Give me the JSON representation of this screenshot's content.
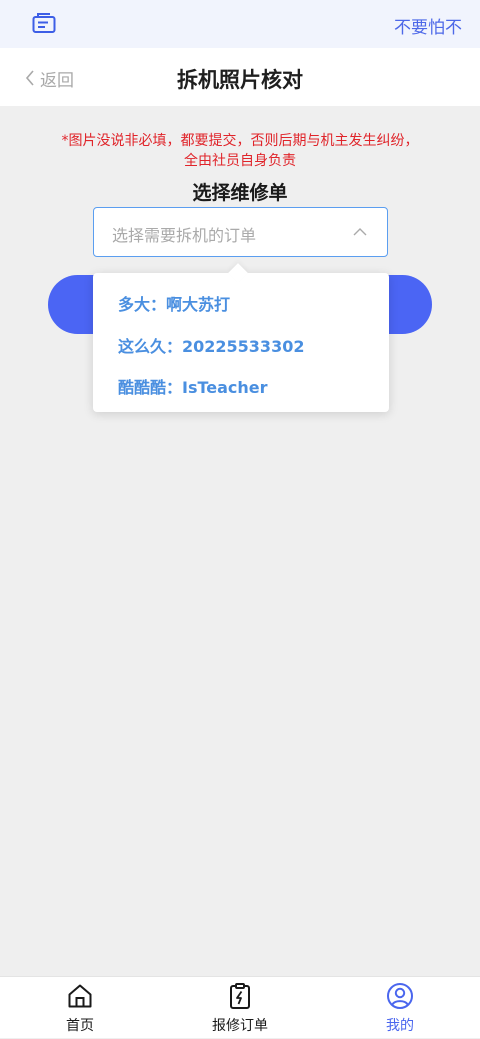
{
  "header": {
    "user_name": "不要怕不"
  },
  "navbar": {
    "back_label": "返回",
    "title": "拆机照片核对"
  },
  "notice": {
    "line1": "*图片没说非必填，都要提交，否则后期与机主发生纠纷，",
    "line2": "全由社员自身负责"
  },
  "form": {
    "section_title": "选择维修单",
    "select_placeholder": "选择需要拆机的订单"
  },
  "dropdown": {
    "options": [
      {
        "label": "多大：啊大苏打"
      },
      {
        "label": "这么久：20225533302"
      },
      {
        "label": "酷酷酷：IsTeacher"
      }
    ]
  },
  "tabbar": {
    "items": [
      {
        "label": "首页",
        "icon": "home-icon"
      },
      {
        "label": "报修订单",
        "icon": "clipboard-icon"
      },
      {
        "label": "我的",
        "icon": "user-circle-icon"
      }
    ],
    "active_index": 2
  },
  "colors": {
    "accent": "#4b65f4",
    "option_text": "#4a8fe0",
    "warning": "#e0242a",
    "topbar_bg": "#f1f4fd"
  }
}
